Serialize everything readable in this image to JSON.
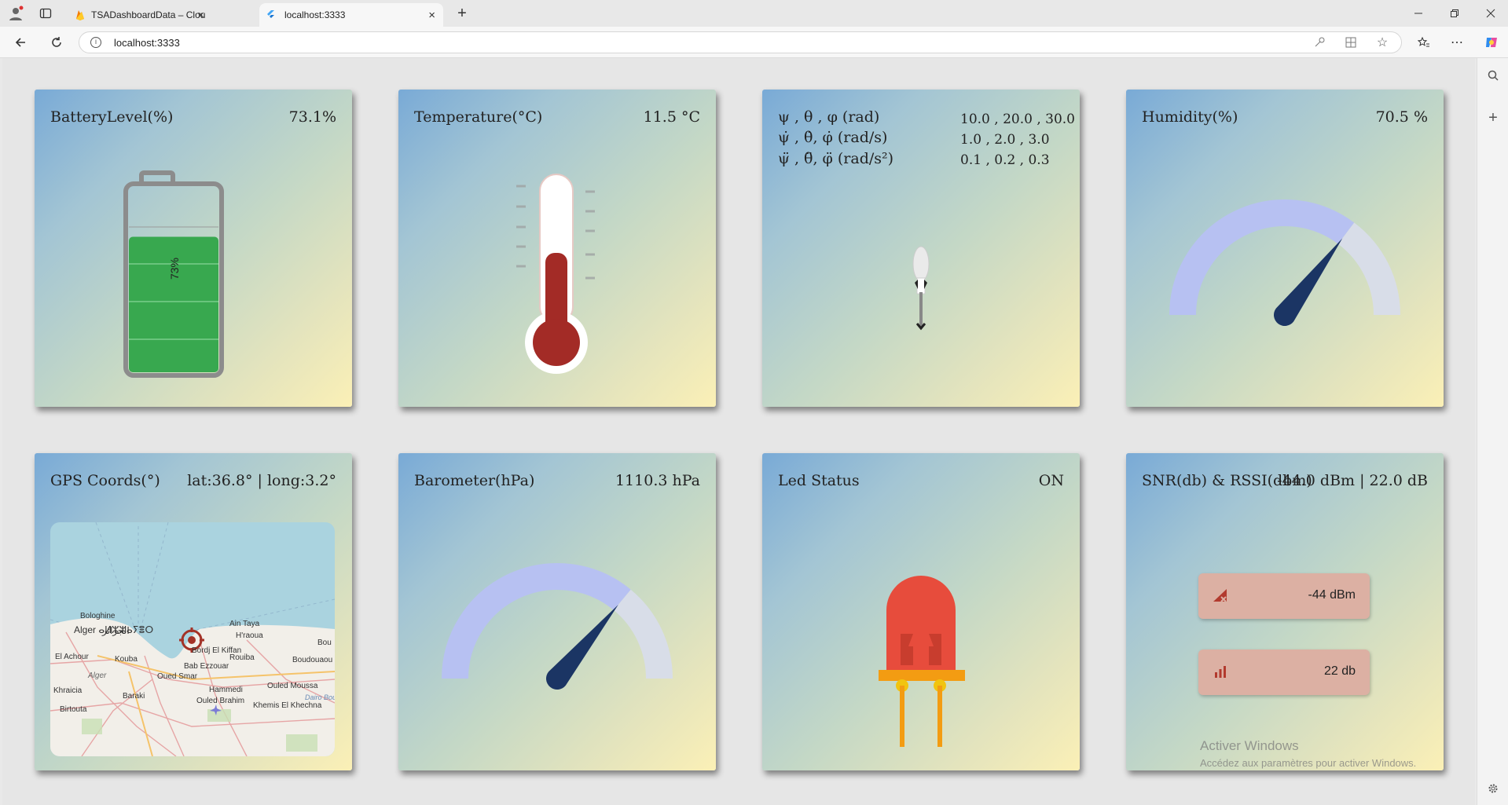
{
  "browser": {
    "tabs": [
      {
        "title": "TSADashboardData – Cloud Firest"
      },
      {
        "title": "localhost:3333"
      }
    ],
    "url": "localhost:3333"
  },
  "cards": {
    "battery": {
      "title": "BatteryLevel(%)",
      "value": "73.1%",
      "label": "73%",
      "level": 0.731
    },
    "temperature": {
      "title": "Temperature(°C)",
      "value": "11.5 °C"
    },
    "orientation": {
      "rows": [
        {
          "label": "ψ , θ , φ (rad)",
          "value": "10.0 , 20.0 , 30.0"
        },
        {
          "label": "ψ̇ , θ̇, φ̇ (rad/s)",
          "value": "1.0 , 2.0 , 3.0"
        },
        {
          "label": "ψ̈ , θ̈, φ̈ (rad/s²)",
          "value": "0.1 , 0.2 , 0.3"
        }
      ]
    },
    "humidity": {
      "title": "Humidity(%)",
      "value": "70.5 %",
      "gauge_fraction": 0.705
    },
    "gps": {
      "title": "GPS Coords(°)",
      "value": "lat:36.8° | long:3.2°",
      "map_labels": [
        "Bologhine",
        "Alger ⴰⵍⵣⵣⴰⵢⴻⵔ",
        "الجزائر",
        "Ain Taya",
        "H'raoua",
        "El Achour",
        "Kouba",
        "Bordj El Kiffan",
        "Rouiba",
        "Boudouaou",
        "Bab Ezzouar",
        "Alger",
        "Oued Smar",
        "Khraicia",
        "Baraki",
        "Hammedi",
        "Ouled Moussa",
        "Ouled Brahim",
        "Khemis El Khechna",
        "Birtouta",
        "Bou",
        "Dairo Bou"
      ]
    },
    "barometer": {
      "title": "Barometer(hPa)",
      "value": "1110.3 hPa",
      "gauge_fraction": 0.72
    },
    "led": {
      "title": "Led Status",
      "value": "ON"
    },
    "signal": {
      "title": "SNR(db) & RSSI(dbm)",
      "value": "-44.0 dBm | 22.0 dB",
      "rssi": "-44 dBm",
      "snr": "22 db"
    }
  },
  "watermark": {
    "line1": "Activer Windows",
    "line2": "Accédez aux paramètres pour activer Windows."
  }
}
